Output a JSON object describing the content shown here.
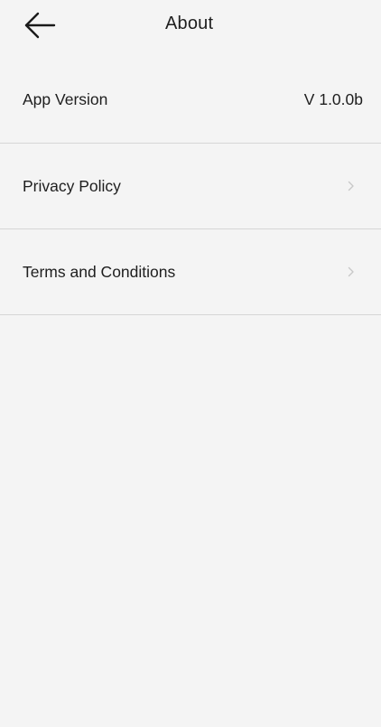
{
  "header": {
    "title": "About"
  },
  "rows": [
    {
      "label": "App Version",
      "value": "V 1.0.0b"
    },
    {
      "label": "Privacy Policy"
    },
    {
      "label": "Terms and Conditions"
    }
  ],
  "colors": {
    "background": "#f4f4f4",
    "divider": "#d6d6d6",
    "chevron": "#c8c8c8"
  },
  "icons": {
    "back": "arrow-left-icon",
    "chevron": "chevron-right-icon"
  }
}
